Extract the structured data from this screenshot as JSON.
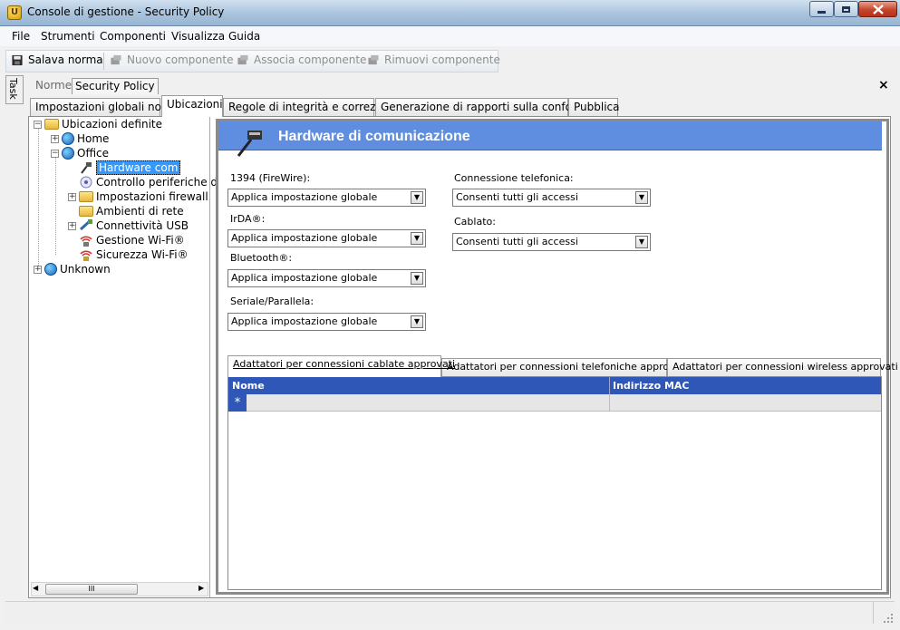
{
  "window": {
    "title": "Console di gestione  - Security Policy",
    "app_icon_glyph": "U"
  },
  "menu": [
    "File",
    "Strumenti",
    "Componenti",
    "Visualizza",
    "Guida"
  ],
  "toolbar": {
    "save": "Salava norma",
    "new": "Nuovo componente",
    "associate": "Associa componente",
    "remove": "Rimuovi componente"
  },
  "task_label": "Task",
  "doc_tabs": {
    "norme": "Norme",
    "security_policy": "Security Policy"
  },
  "close_glyph": "×",
  "main_tabs": [
    "Impostazioni globali norme",
    "Ubicazioni",
    "Regole di integrità e correzione",
    "Generazione di rapporti sulla conformità",
    "Pubblica"
  ],
  "tree": {
    "root": "Ubicazioni definite",
    "home": "Home",
    "office": "Office",
    "children": [
      "Hardware com",
      "Controllo periferiche di",
      "Impostazioni firewall",
      "Ambienti di rete",
      "Connettività USB",
      "Gestione Wi-Fi®",
      "Sicurezza Wi-Fi®"
    ],
    "unknown": "Unknown"
  },
  "scroll_thumb_glyph": "III",
  "section": {
    "title": "Hardware di comunicazione"
  },
  "fields": {
    "firewire": {
      "label": "1394 (FireWire):",
      "value": "Applica impostazione globale"
    },
    "irda": {
      "label": "IrDA®:",
      "value": "Applica impostazione globale"
    },
    "bluetooth": {
      "label": "Bluetooth®:",
      "value": "Applica impostazione globale"
    },
    "serial": {
      "label": "Seriale/Parallela:",
      "value": "Applica impostazione globale"
    },
    "dialup": {
      "label": "Connessione telefonica:",
      "value": "Consenti tutti gli accessi"
    },
    "wired": {
      "label": "Cablato:",
      "value": "Consenti tutti gli accessi"
    }
  },
  "adapter_tabs": [
    "Adattatori per connessioni cablate approvati",
    "Adattatori per connessioni telefoniche approvati",
    "Adattatori per connessioni wireless approvati"
  ],
  "grid": {
    "columns": [
      "Nome",
      "Indirizzo MAC"
    ],
    "new_row_glyph": "*"
  },
  "colors": {
    "header_blue": "#5f8de0",
    "grid_head": "#2f57b7",
    "selection": "#3399ff"
  }
}
